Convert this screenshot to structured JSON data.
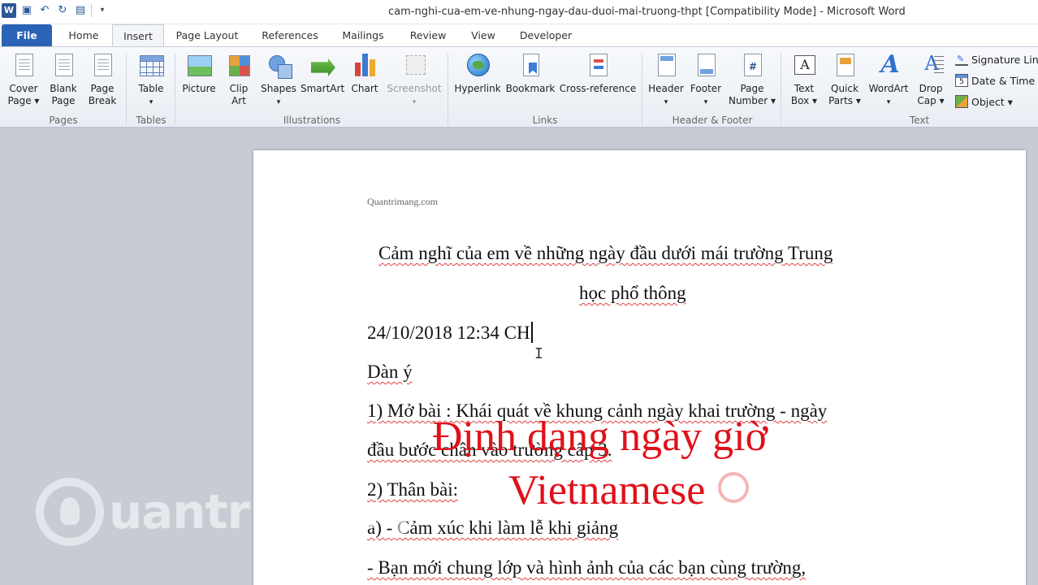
{
  "window": {
    "title": "cam-nghi-cua-em-ve-nhung-ngay-dau-duoi-mai-truong-thpt [Compatibility Mode]  -  Microsoft Word"
  },
  "qat": {
    "logo": "W"
  },
  "tabs": {
    "file": "File",
    "home": "Home",
    "insert": "Insert",
    "page_layout": "Page Layout",
    "references": "References",
    "mailings": "Mailings",
    "review": "Review",
    "view": "View",
    "developer": "Developer"
  },
  "ribbon": {
    "pages": {
      "group": "Pages",
      "cover_page": [
        "Cover",
        "Page ▾"
      ],
      "blank_page": [
        "Blank",
        "Page"
      ],
      "page_break": [
        "Page",
        "Break"
      ]
    },
    "tables": {
      "group": "Tables",
      "table": [
        "Table",
        "▾"
      ]
    },
    "illustrations": {
      "group": "Illustrations",
      "picture": "Picture",
      "clip_art": [
        "Clip",
        "Art"
      ],
      "shapes": [
        "Shapes",
        "▾"
      ],
      "smartart": "SmartArt",
      "chart": "Chart",
      "screenshot": [
        "Screenshot",
        "▾"
      ]
    },
    "links": {
      "group": "Links",
      "hyperlink": "Hyperlink",
      "bookmark": "Bookmark",
      "cross_reference": "Cross-reference"
    },
    "header_footer": {
      "group": "Header & Footer",
      "header": [
        "Header",
        "▾"
      ],
      "footer": [
        "Footer",
        "▾"
      ],
      "page_number": [
        "Page",
        "Number ▾"
      ]
    },
    "text": {
      "group": "Text",
      "text_box": [
        "Text",
        "Box ▾"
      ],
      "quick_parts": [
        "Quick",
        "Parts ▾"
      ],
      "wordart": [
        "WordArt",
        "▾"
      ],
      "drop_cap": [
        "Drop",
        "Cap ▾"
      ],
      "signature_line": "Signature Line",
      "date_time": "Date & Time",
      "object": "Object ▾"
    }
  },
  "document": {
    "header_site": "Quantrimang.com",
    "title_line1": "Cảm nghĩ của em về những ngày đầu dưới mái trường Trung",
    "title_line2": "học phổ thông",
    "datetime_line": "24/10/2018  12:34 CH",
    "outline_label": "Dàn ý",
    "item1_line1": "1) Mở bài : Khái quát về khung cảnh ngày khai trường - ngày",
    "item1_line2": "đầu bước chân vào trường cấp 3.",
    "item2": "2) Thân bài:",
    "item2a": "a) - Cảm xúc khi làm lễ khi giảng",
    "item2a_detail": "- Bạn mới chung lớp và hình ảnh của các bạn cùng trường,"
  },
  "overlay": {
    "line1": "Định dạng ngày giờ",
    "line2": "Vietnamese"
  },
  "watermark": {
    "text": "uantrimang"
  },
  "colors": {
    "file_tab": "#2b63b6",
    "overlay_text": "#e0101a",
    "spell_squiggle": "#e04040"
  }
}
